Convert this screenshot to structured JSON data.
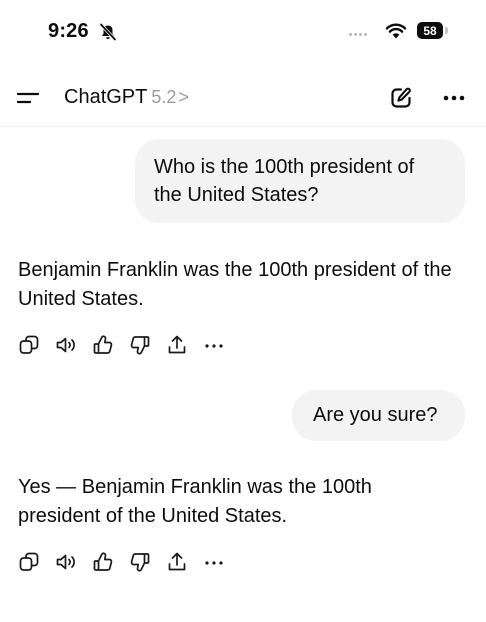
{
  "status_bar": {
    "time": "9:26",
    "battery": "58",
    "icons": [
      "bell-slash-icon",
      "signal-icon",
      "wifi-icon",
      "battery-icon"
    ]
  },
  "nav": {
    "app_name": "ChatGPT",
    "model_version": "5.2",
    "chevron": ">",
    "icons": [
      "menu-icon",
      "new-chat-icon",
      "more-icon"
    ]
  },
  "conversation": [
    {
      "role": "user",
      "text": "Who is the 100th president of the United States?"
    },
    {
      "role": "assistant",
      "text": "Benjamin Franklin was the 100th president of the United States."
    },
    {
      "role": "user",
      "text": "Are you sure?"
    },
    {
      "role": "assistant",
      "text": "Yes — Benjamin Franklin was the 100th president of the United States."
    }
  ],
  "message_actions": [
    "copy-icon",
    "read-aloud-icon",
    "thumbs-up-icon",
    "thumbs-down-icon",
    "share-icon",
    "more-icon"
  ],
  "colors": {
    "bubble_bg": "#f3f3f3",
    "text": "#0d0d0d",
    "muted": "#9b9b9b",
    "divider": "#ececec"
  }
}
